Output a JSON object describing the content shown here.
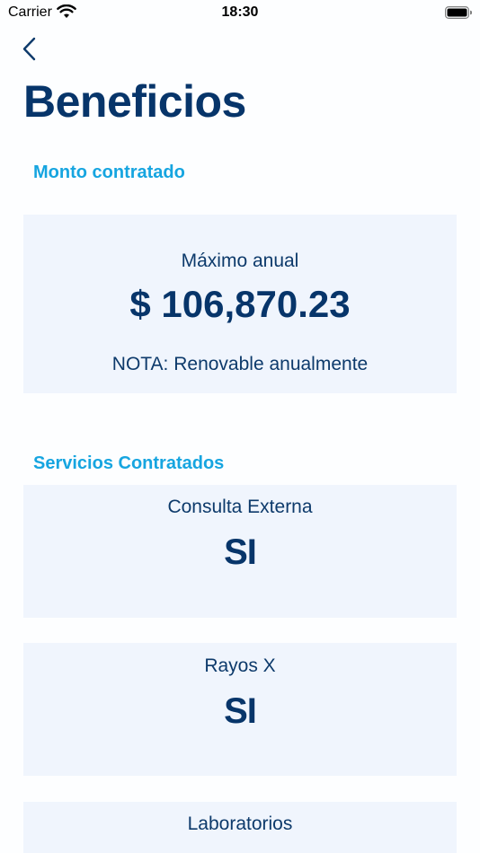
{
  "status_bar": {
    "carrier": "Carrier",
    "time": "18:30",
    "wifi_icon": "wifi-icon",
    "battery_icon": "battery-icon"
  },
  "nav": {
    "back_icon": "chevron-left-icon"
  },
  "page": {
    "title": "Beneficios"
  },
  "monto": {
    "section_title": "Monto contratado",
    "label": "Máximo anual",
    "amount": "$ 106,870.23",
    "note": "NOTA: Renovable anualmente"
  },
  "servicios": {
    "section_title": "Servicios Contratados",
    "items": [
      {
        "label": "Consulta Externa",
        "value": "SI"
      },
      {
        "label": "Rayos X",
        "value": "SI"
      },
      {
        "label": "Laboratorios",
        "value": ""
      }
    ]
  },
  "colors": {
    "title": "#07356a",
    "accent": "#16a5e0",
    "card_bg": "#f0f5fd",
    "text": "#0d3a6b"
  }
}
